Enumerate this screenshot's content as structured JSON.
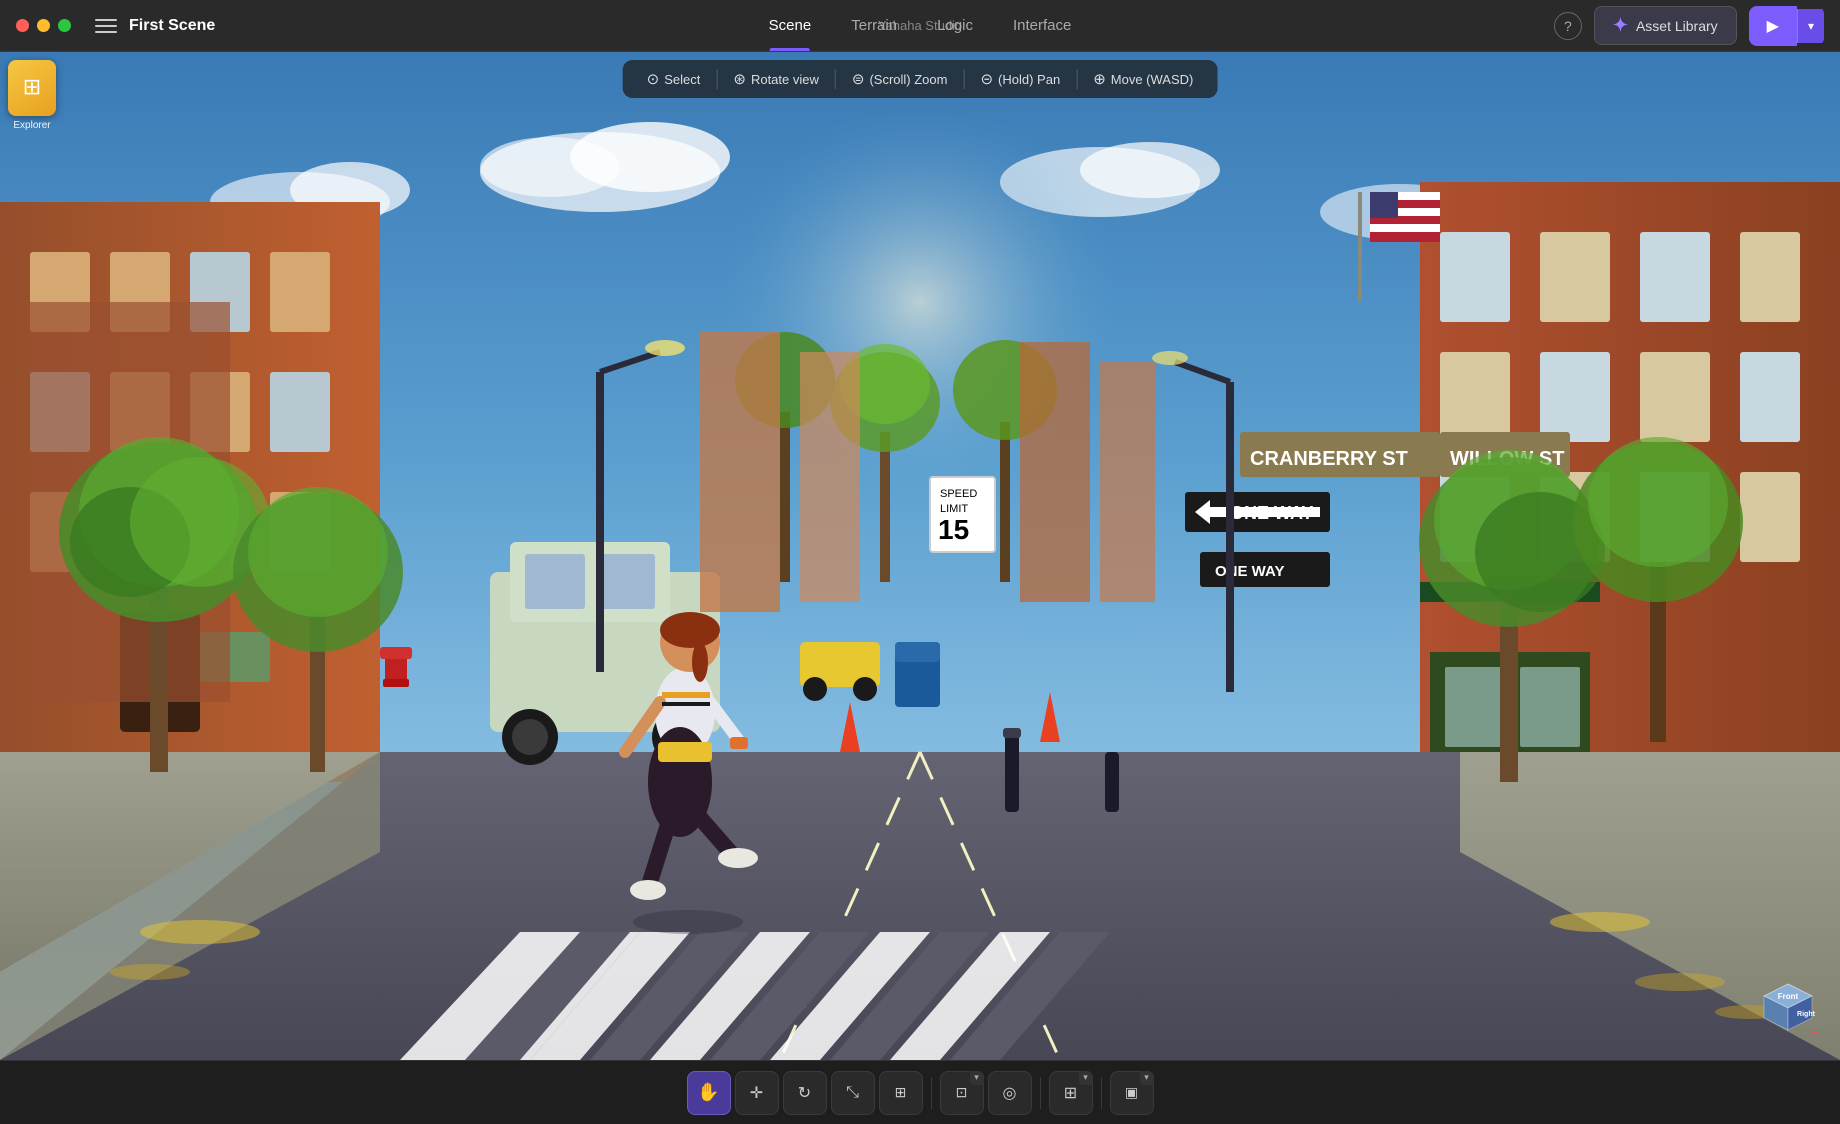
{
  "app": {
    "title": "Yahaha Studio"
  },
  "titlebar": {
    "scene_name": "First Scene",
    "window_controls": {
      "close": "close",
      "minimize": "minimize",
      "maximize": "maximize"
    }
  },
  "nav": {
    "tabs": [
      {
        "id": "scene",
        "label": "Scene",
        "active": true
      },
      {
        "id": "terrain",
        "label": "Terrain",
        "active": false
      },
      {
        "id": "logic",
        "label": "Logic",
        "active": false
      },
      {
        "id": "interface",
        "label": "Interface",
        "active": false
      }
    ]
  },
  "toolbar_right": {
    "help_label": "?",
    "asset_library_label": "Asset Library",
    "play_label": "▶"
  },
  "viewport_toolbar": {
    "select_label": "Select",
    "rotate_label": "Rotate view",
    "zoom_label": "(Scroll) Zoom",
    "pan_label": "(Hold) Pan",
    "move_label": "Move (WASD)"
  },
  "explorer": {
    "label": "Explorer",
    "icon": "🗂"
  },
  "bottom_toolbar": {
    "tools": [
      {
        "id": "hand",
        "icon": "✋",
        "active": true,
        "has_expand": false
      },
      {
        "id": "move",
        "icon": "⊕",
        "active": false,
        "has_expand": false
      },
      {
        "id": "rotate",
        "icon": "↺",
        "active": false,
        "has_expand": false
      },
      {
        "id": "scale",
        "icon": "⤢",
        "active": false,
        "has_expand": false
      },
      {
        "id": "transform",
        "icon": "⊞",
        "active": false,
        "has_expand": false
      },
      {
        "id": "snap",
        "icon": "⊡",
        "active": false,
        "has_expand": true
      },
      {
        "id": "center",
        "icon": "◎",
        "active": false,
        "has_expand": false
      },
      {
        "id": "grid",
        "icon": "⊞",
        "active": false,
        "has_expand": true
      },
      {
        "id": "frame",
        "icon": "▣",
        "active": false,
        "has_expand": true
      }
    ]
  },
  "gizmo": {
    "front_label": "Front",
    "right_label": "Right"
  },
  "colors": {
    "accent_purple": "#7c5cfc",
    "active_tab_indicator": "#7c5cfc",
    "bg_dark": "#1e1e1e",
    "bg_mid": "#2a2a2a",
    "toolbar_bg": "rgba(30,30,30,0.75)"
  }
}
